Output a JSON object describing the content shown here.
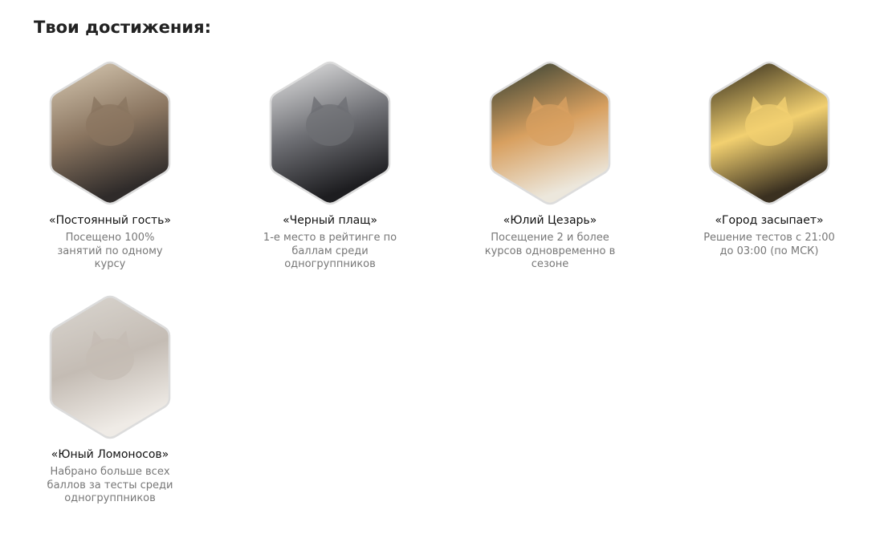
{
  "page_title": "Твои достижения:",
  "achievements": [
    {
      "title": "«Постоянный гость»",
      "description": "Посещено 100% занятий по одному курсу",
      "colors": [
        "#d9cbb4",
        "#8a7560",
        "#2f2b2a"
      ]
    },
    {
      "title": "«Черный плащ»",
      "description": "1-е место в рейтинге по баллам среди одногруппников",
      "colors": [
        "#e8e8e8",
        "#6e6f74",
        "#1d1d20"
      ]
    },
    {
      "title": "«Юлий Цезарь»",
      "description": "Посещение 2 и более курсов одновременно в сезоне",
      "colors": [
        "#2d3b30",
        "#d8a060",
        "#ece7dc"
      ]
    },
    {
      "title": "«Город засыпает»",
      "description": "Решение тестов с 21:00 до 03:00 (по МСК)",
      "colors": [
        "#2a2418",
        "#f2d070",
        "#3a3020"
      ]
    },
    {
      "title": "«Юный Ломоносов»",
      "description": "Набрано больше всех баллов за тесты среди одногруппников",
      "colors": [
        "#dad6d0",
        "#c4bcb4",
        "#efebe6"
      ]
    }
  ]
}
